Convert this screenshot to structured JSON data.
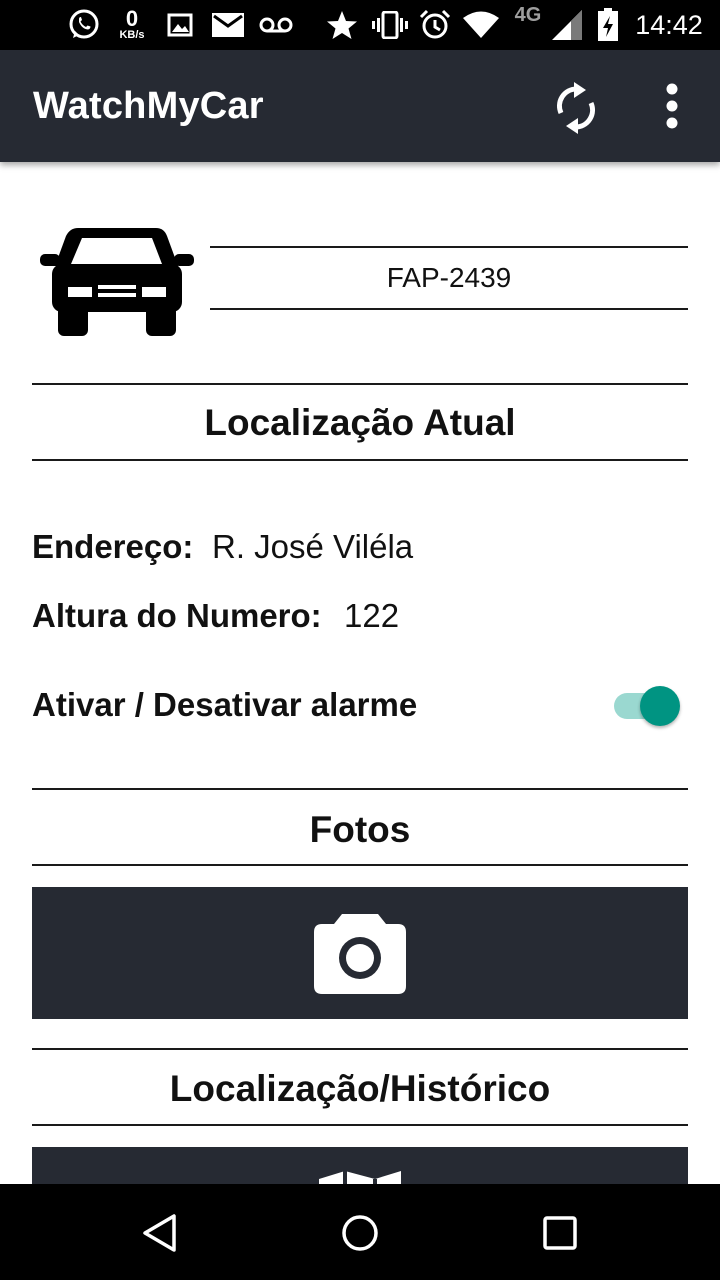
{
  "status_bar": {
    "net_speed_value": "0",
    "net_speed_unit": "KB/s",
    "network_type": "4G",
    "time": "14:42",
    "icons": [
      "whatsapp-icon",
      "image-icon",
      "mail-icon",
      "voicemail-icon",
      "star-icon",
      "vibrate-icon",
      "alarm-clock-icon",
      "wifi-icon",
      "signal-icon",
      "battery-icon"
    ]
  },
  "app_bar": {
    "title": "WatchMyCar",
    "actions": [
      "refresh-icon",
      "more-vert-icon"
    ]
  },
  "vehicle": {
    "icon": "car-icon",
    "plate": "FAP-2439"
  },
  "location_section": {
    "title": "Localização Atual",
    "address_label": "Endereço:",
    "address_value": "R. José Viléla",
    "number_label": "Altura do Numero:",
    "number_value": "122",
    "alarm_label": "Ativar / Desativar alarme",
    "alarm_on": true
  },
  "photos_section": {
    "title": "Fotos",
    "button_icon": "camera-icon"
  },
  "history_section": {
    "title": "Localização/Histórico",
    "button_icon": "map-icon"
  },
  "colors": {
    "app_bar": "#262a33",
    "accent": "#009482",
    "accent_track": "#9ad8d0",
    "panel": "#262a33"
  },
  "nav_bar": {
    "icons": [
      "back-icon",
      "home-icon",
      "recents-icon"
    ]
  }
}
